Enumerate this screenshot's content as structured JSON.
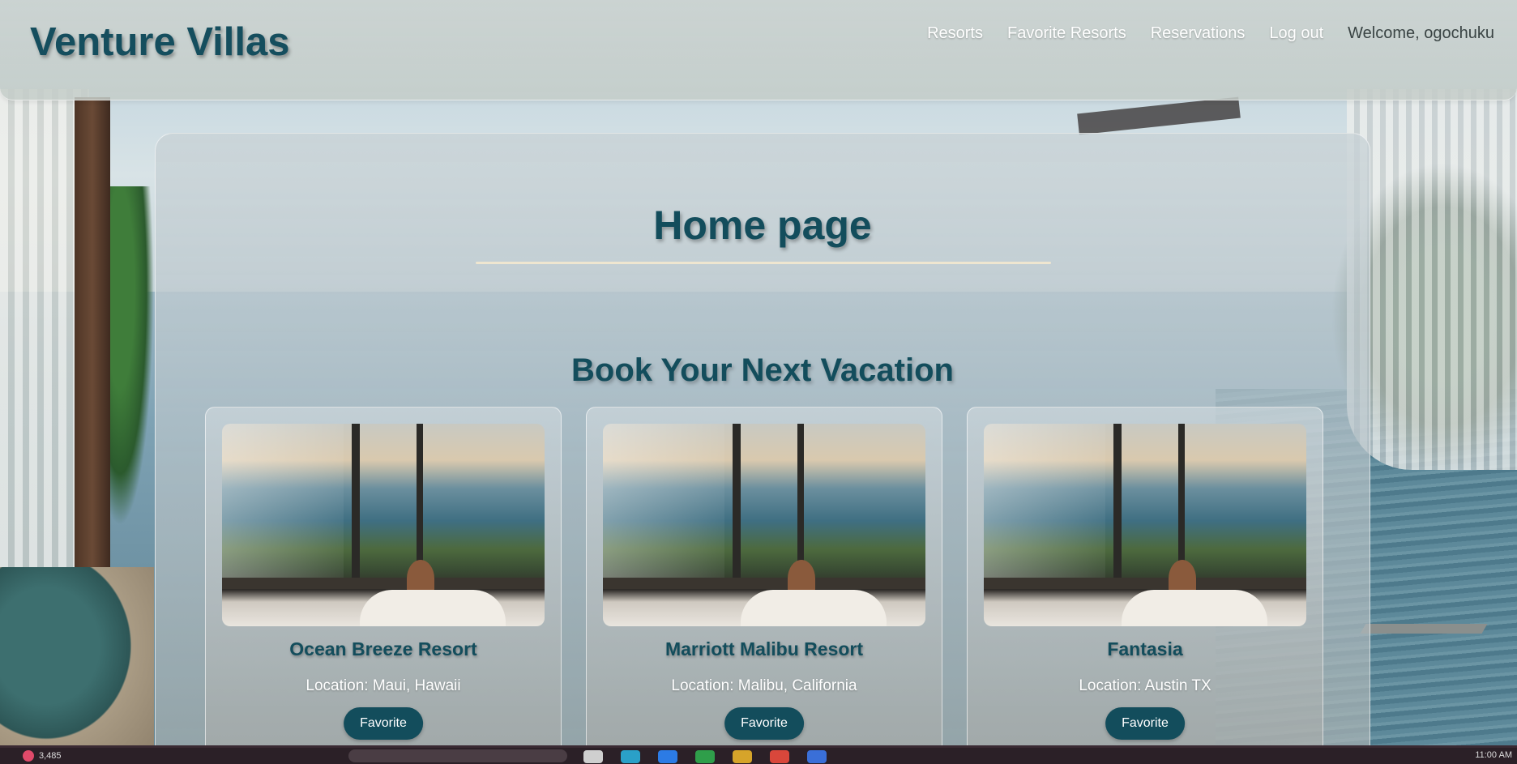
{
  "header": {
    "brand": "Venture Villas",
    "nav": [
      {
        "label": "Resorts"
      },
      {
        "label": "Favorite Resorts"
      },
      {
        "label": "Reservations"
      },
      {
        "label": "Log out"
      }
    ],
    "welcome": "Welcome, ogochuku"
  },
  "main": {
    "page_title": "Home page",
    "section_title": "Book Your Next Vacation",
    "resorts": [
      {
        "name": "Ocean Breeze Resort",
        "location": "Location: Maui, Hawaii",
        "button": "Favorite"
      },
      {
        "name": "Marriott Malibu Resort",
        "location": "Location: Malibu, California",
        "button": "Favorite"
      },
      {
        "name": "Fantasia",
        "location": "Location: Austin TX",
        "button": "Favorite"
      }
    ]
  },
  "taskbar": {
    "weather": "3,485",
    "clock": "11:00 AM"
  },
  "colors": {
    "brand": "#134d5c",
    "button_bg": "#134d5c",
    "rule": "#efe6d0"
  }
}
